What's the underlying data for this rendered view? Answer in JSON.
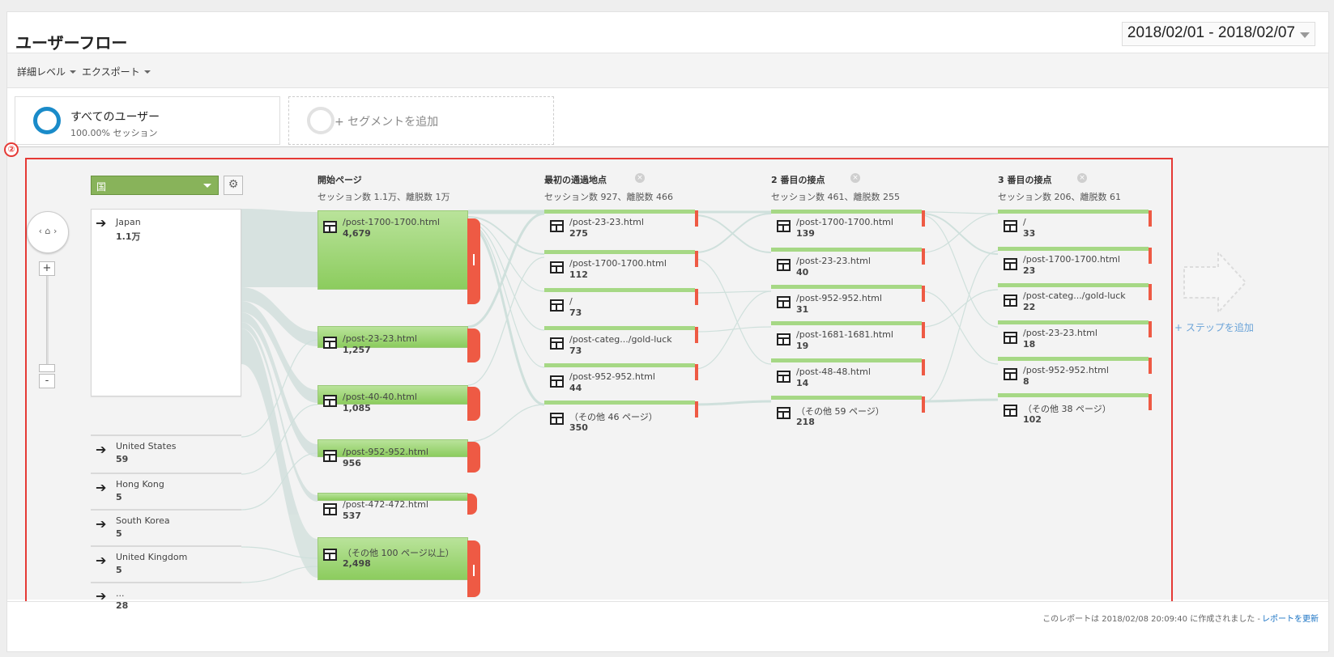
{
  "header": {
    "title": "ユーザーフロー",
    "date_range": "2018/02/01 - 2018/02/07"
  },
  "toolbar": {
    "detail_level": "詳細レベル",
    "export": "エクスポート"
  },
  "segments": {
    "all_users": {
      "title": "すべてのユーザー",
      "sub": "100.00% セッション"
    },
    "add": {
      "label": "+ セグメントを追加"
    }
  },
  "flow": {
    "marker": "②",
    "dimension": "国",
    "columns": [
      {
        "title": "開始ページ",
        "sub": "セッション数 1.1万、離脱数 1万"
      },
      {
        "title": "最初の通過地点",
        "sub": "セッション数 927、離脱数 466"
      },
      {
        "title": "2 番目の接点",
        "sub": "セッション数 461、離脱数 255"
      },
      {
        "title": "3 番目の接点",
        "sub": "セッション数 206、離脱数 61"
      }
    ],
    "countries": [
      {
        "name": "Japan",
        "value": "1.1万"
      },
      {
        "name": "United States",
        "value": "59"
      },
      {
        "name": "Hong Kong",
        "value": "5"
      },
      {
        "name": "South Korea",
        "value": "5"
      },
      {
        "name": "United Kingdom",
        "value": "5"
      },
      {
        "name": "...",
        "value": "28"
      }
    ],
    "start_pages": [
      {
        "label": "/post-1700-1700.html",
        "value": "4,679"
      },
      {
        "label": "/post-23-23.html",
        "value": "1,257"
      },
      {
        "label": "/post-40-40.html",
        "value": "1,085"
      },
      {
        "label": "/post-952-952.html",
        "value": "956"
      },
      {
        "label": "/post-472-472.html",
        "value": "537"
      },
      {
        "label": "（その他 100 ページ以上）",
        "value": "2,498"
      }
    ],
    "step1": [
      {
        "label": "/post-23-23.html",
        "value": "275"
      },
      {
        "label": "/post-1700-1700.html",
        "value": "112"
      },
      {
        "label": "/",
        "value": "73"
      },
      {
        "label": "/post-categ.../gold-luck",
        "value": "73"
      },
      {
        "label": "/post-952-952.html",
        "value": "44"
      },
      {
        "label": "（その他 46 ページ）",
        "value": "350"
      }
    ],
    "step2": [
      {
        "label": "/post-1700-1700.html",
        "value": "139"
      },
      {
        "label": "/post-23-23.html",
        "value": "40"
      },
      {
        "label": "/post-952-952.html",
        "value": "31"
      },
      {
        "label": "/post-1681-1681.html",
        "value": "19"
      },
      {
        "label": "/post-48-48.html",
        "value": "14"
      },
      {
        "label": "（その他 59 ページ）",
        "value": "218"
      }
    ],
    "step3": [
      {
        "label": "/",
        "value": "33"
      },
      {
        "label": "/post-1700-1700.html",
        "value": "23"
      },
      {
        "label": "/post-categ.../gold-luck",
        "value": "22"
      },
      {
        "label": "/post-23-23.html",
        "value": "18"
      },
      {
        "label": "/post-952-952.html",
        "value": "8"
      },
      {
        "label": "（その他 38 ページ）",
        "value": "102"
      }
    ],
    "add_step": "+ ステップを追加"
  },
  "footer": {
    "text": "このレポートは 2018/02/08 20:09:40 に作成されました -",
    "refresh": "レポートを更新"
  }
}
